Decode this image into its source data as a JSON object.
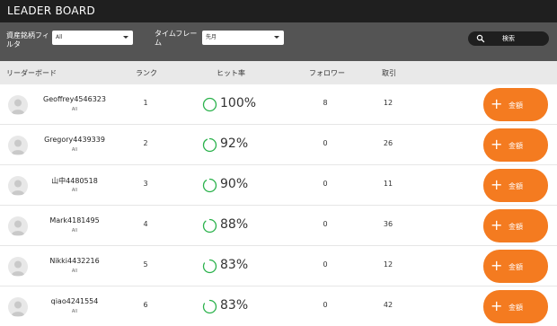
{
  "header": {
    "title": "LEADER BOARD"
  },
  "filters": {
    "asset_label": "資産銘柄フィルタ",
    "asset_value": "All",
    "timeframe_label": "タイムフレーム",
    "timeframe_value": "先月",
    "search_label": "検索"
  },
  "table": {
    "columns": {
      "board": "リーダーボード",
      "rank": "ランク",
      "hit_rate": "ヒット率",
      "followers": "フォロワー",
      "trades": "取引"
    },
    "rows": [
      {
        "name": "Geoffrey4546323",
        "sub": "All",
        "rank": "1",
        "hit": "100%",
        "hit_value": 100,
        "followers": "8",
        "trades": "12",
        "button": "金額"
      },
      {
        "name": "Gregory4439339",
        "sub": "All",
        "rank": "2",
        "hit": "92%",
        "hit_value": 92,
        "followers": "0",
        "trades": "26",
        "button": "金額"
      },
      {
        "name": "山中4480518",
        "sub": "All",
        "rank": "3",
        "hit": "90%",
        "hit_value": 90,
        "followers": "0",
        "trades": "11",
        "button": "金額"
      },
      {
        "name": "Mark4181495",
        "sub": "All",
        "rank": "4",
        "hit": "88%",
        "hit_value": 88,
        "followers": "0",
        "trades": "36",
        "button": "金額"
      },
      {
        "name": "Nikki4432216",
        "sub": "All",
        "rank": "5",
        "hit": "83%",
        "hit_value": 83,
        "followers": "0",
        "trades": "12",
        "button": "金額"
      },
      {
        "name": "qiao4241554",
        "sub": "All",
        "rank": "6",
        "hit": "83%",
        "hit_value": 83,
        "followers": "0",
        "trades": "42",
        "button": "金額"
      }
    ]
  },
  "colors": {
    "accent": "#f47b20",
    "ring": "#2bb24c",
    "topbar": "#1f1f1f",
    "filterbar": "#545454"
  },
  "icons": {
    "search": "search-icon",
    "avatar": "user-avatar-icon",
    "plus": "plus-icon",
    "caret": "chevron-down-icon"
  }
}
